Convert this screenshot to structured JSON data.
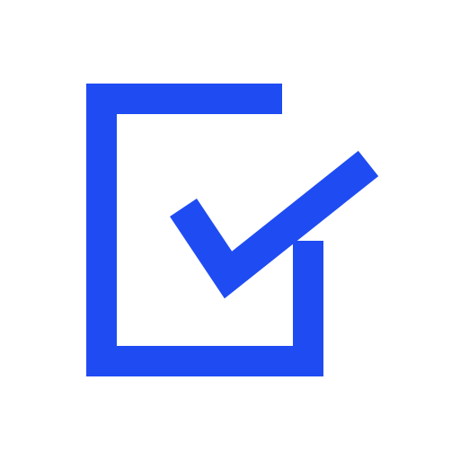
{
  "icon": {
    "name": "checkbox-checked-icon",
    "color": "#1f4cf2",
    "background": "#ffffff"
  }
}
